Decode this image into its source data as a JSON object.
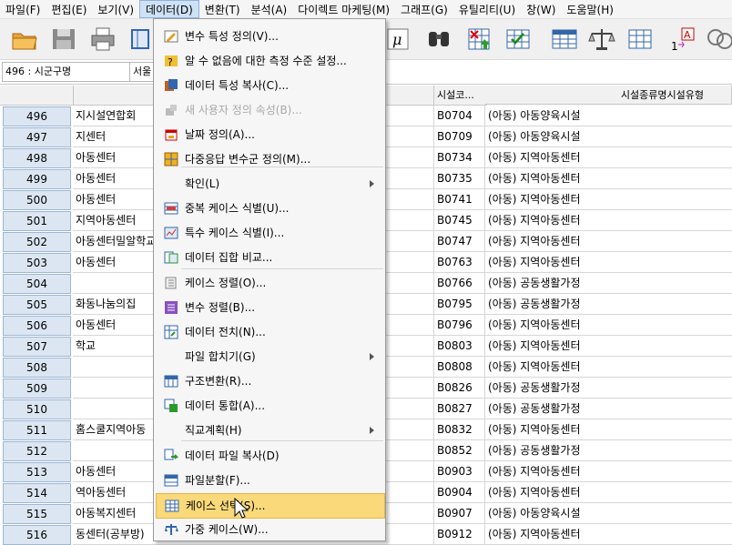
{
  "menubar": [
    "파일(F)",
    "편집(E)",
    "보기(V)",
    "데이터(D)",
    "변환(T)",
    "분석(A)",
    "다이렉트 마케팅(M)",
    "그래프(G)",
    "유틸리티(U)",
    "창(W)",
    "도움말(H)"
  ],
  "editbar": {
    "cell_ref": "496 : 시군구명",
    "cell_value": "서울"
  },
  "columns": {
    "code": "시설코...",
    "type": "시설종류명시설유형"
  },
  "rows": [
    {
      "n": "496",
      "name": "지시설연합회",
      "code": "B0704",
      "type": "(아동) 아동양육시설"
    },
    {
      "n": "497",
      "name": "지센터",
      "code": "B0709",
      "type": "(아동) 아동양육시설"
    },
    {
      "n": "498",
      "name": "아동센터",
      "code": "B0734",
      "type": "(아동) 지역아동센터"
    },
    {
      "n": "499",
      "name": "아동센터",
      "code": "B0735",
      "type": "(아동) 지역아동센터"
    },
    {
      "n": "500",
      "name": "아동센터",
      "code": "B0741",
      "type": "(아동) 지역아동센터"
    },
    {
      "n": "501",
      "name": "지역아동센터",
      "code": "B0745",
      "type": "(아동) 지역아동센터"
    },
    {
      "n": "502",
      "name": "아동센터밀알학교",
      "code": "B0747",
      "type": "(아동) 지역아동센터"
    },
    {
      "n": "503",
      "name": "아동센터",
      "code": "B0763",
      "type": "(아동) 지역아동센터"
    },
    {
      "n": "504",
      "name": "",
      "code": "B0766",
      "type": "(아동) 공동생활가정"
    },
    {
      "n": "505",
      "name": "화동나눔의집",
      "code": "B0795",
      "type": "(아동) 공동생활가정"
    },
    {
      "n": "506",
      "name": "아동센터",
      "code": "B0796",
      "type": "(아동) 지역아동센터"
    },
    {
      "n": "507",
      "name": "학교",
      "code": "B0803",
      "type": "(아동) 지역아동센터"
    },
    {
      "n": "508",
      "name": "",
      "code": "B0808",
      "type": "(아동) 지역아동센터"
    },
    {
      "n": "509",
      "name": "",
      "code": "B0826",
      "type": "(아동) 공동생활가정"
    },
    {
      "n": "510",
      "name": "",
      "code": "B0827",
      "type": "(아동) 공동생활가정"
    },
    {
      "n": "511",
      "name": "홈스쿨지역아동",
      "code": "B0832",
      "type": "(아동) 지역아동센터"
    },
    {
      "n": "512",
      "name": "",
      "code": "B0852",
      "type": "(아동) 공동생활가정"
    },
    {
      "n": "513",
      "name": "아동센터",
      "code": "B0903",
      "type": "(아동) 지역아동센터"
    },
    {
      "n": "514",
      "name": "역아동센터",
      "code": "B0904",
      "type": "(아동) 지역아동센터"
    },
    {
      "n": "515",
      "name": "아동복지센터",
      "code": "B0907",
      "type": "(아동) 아동양육시설"
    },
    {
      "n": "516",
      "name": "동센터(공부방)",
      "code": "B0912",
      "type": "(아동) 지역아동센터"
    }
  ],
  "menu": [
    {
      "label": "변수 특성 정의(V)...",
      "icon": "variable-properties-icon"
    },
    {
      "label": "알 수 없음에 대한 측정 수준 설정...",
      "icon": "measure-level-icon"
    },
    {
      "label": "데이터 특성 복사(C)...",
      "icon": "copy-properties-icon"
    },
    {
      "label": "새 사용자 정의 속성(B)...",
      "icon": "custom-attribute-icon",
      "disabled": true
    },
    {
      "label": "날짜 정의(A)...",
      "icon": "calendar-icon"
    },
    {
      "label": "다중응답 변수군 정의(M)...",
      "icon": "multiple-response-icon"
    },
    {
      "label": "확인(L)",
      "submenu": true
    },
    {
      "label": "중복 케이스 식별(U)...",
      "icon": "duplicate-cases-icon"
    },
    {
      "label": "특수 케이스 식별(I)...",
      "icon": "unusual-cases-icon"
    },
    {
      "label": "데이터 집합 비교...",
      "icon": "compare-datasets-icon"
    },
    {
      "label": "케이스 정렬(O)...",
      "icon": "sort-cases-icon"
    },
    {
      "label": "변수 정렬(B)...",
      "icon": "sort-variables-icon"
    },
    {
      "label": "데이터 전치(N)...",
      "icon": "transpose-icon"
    },
    {
      "label": "파일 합치기(G)",
      "submenu": true
    },
    {
      "label": "구조변환(R)...",
      "icon": "restructure-icon"
    },
    {
      "label": "데이터 통합(A)...",
      "icon": "aggregate-icon"
    },
    {
      "label": "직교계획(H)",
      "submenu": true
    },
    {
      "label": "데이터 파일 복사(D)",
      "icon": "copy-dataset-icon"
    },
    {
      "label": "파일분할(F)...",
      "icon": "split-file-icon"
    },
    {
      "label": "케이스 선택(S)...",
      "icon": "select-cases-icon",
      "highlight": true
    },
    {
      "label": "가중 케이스(W)...",
      "icon": "weight-cases-icon"
    }
  ],
  "colors": {
    "menu_highlight": "#f9d97a",
    "row_header": "#dbe6f2",
    "menubar_active": "#cfe1f5"
  }
}
